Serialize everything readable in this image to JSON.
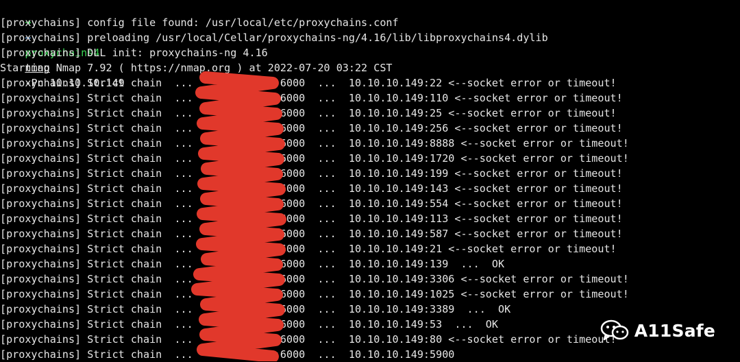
{
  "colors": {
    "background": "#000000",
    "text": "#e6e6e6",
    "prompt_green": "#39d353",
    "prompt_blue": "#6fb7ff",
    "redaction_red": "#e1382b"
  },
  "prompt": {
    "arrow": "➜",
    "tilde": "~",
    "program": "proxychains4",
    "command": "nmap",
    "args": "-Pn 10.10.10.149"
  },
  "lines": [
    "[proxychains] config file found: /usr/local/etc/proxychains.conf",
    "[proxychains] preloading /usr/local/Cellar/proxychains-ng/4.16/lib/libproxychains4.dylib",
    "[proxychains] DLL init: proxychains-ng 4.16",
    "Starting Nmap 7.92 ( https://nmap.org ) at 2022-07-20 03:22 CST",
    "[proxychains] Strict chain  ...             :6000  ...  10.10.10.149:22 <--socket error or timeout!",
    "[proxychains] Strict chain  ...             :6000  ...  10.10.10.149:110 <--socket error or timeout!",
    "[proxychains] Strict chain  ...             :6000  ...  10.10.10.149:25 <--socket error or timeout!",
    "[proxychains] Strict chain  ...             :6000  ...  10.10.10.149:256 <--socket error or timeout!",
    "[proxychains] Strict chain  ...             :6000  ...  10.10.10.149:8888 <--socket error or timeout!",
    "[proxychains] Strict chain  ...             :6000  ...  10.10.10.149:1720 <--socket error or timeout!",
    "[proxychains] Strict chain  ...             :6000  ...  10.10.10.149:199 <--socket error or timeout!",
    "[proxychains] Strict chain  ...             :6000  ...  10.10.10.149:143 <--socket error or timeout!",
    "[proxychains] Strict chain  ...             :6000  ...  10.10.10.149:554 <--socket error or timeout!",
    "[proxychains] Strict chain  ...             :6000  ...  10.10.10.149:113 <--socket error or timeout!",
    "[proxychains] Strict chain  ...             :6000  ...  10.10.10.149:587 <--socket error or timeout!",
    "[proxychains] Strict chain  ...             :6000  ...  10.10.10.149:21 <--socket error or timeout!",
    "[proxychains] Strict chain  ...             :6000  ...  10.10.10.149:139  ...  OK",
    "[proxychains] Strict chain  ...             :6000  ...  10.10.10.149:3306 <--socket error or timeout!",
    "[proxychains] Strict chain  ...             :6000  ...  10.10.10.149:1025 <--socket error or timeout!",
    "[proxychains] Strict chain  ...             :6000  ...  10.10.10.149:3389  ...  OK",
    "[proxychains] Strict chain  ...             :6000  ...  10.10.10.149:53  ...  OK",
    "[proxychains] Strict chain  ...             :6000  ...  10.10.10.149:80 <--socket error or timeout!",
    "[proxychains] Strict chain  ...             :6000  ...  10.10.10.149:5900"
  ],
  "watermark": {
    "icon": "wechat-icon",
    "text": "A11Safe"
  }
}
